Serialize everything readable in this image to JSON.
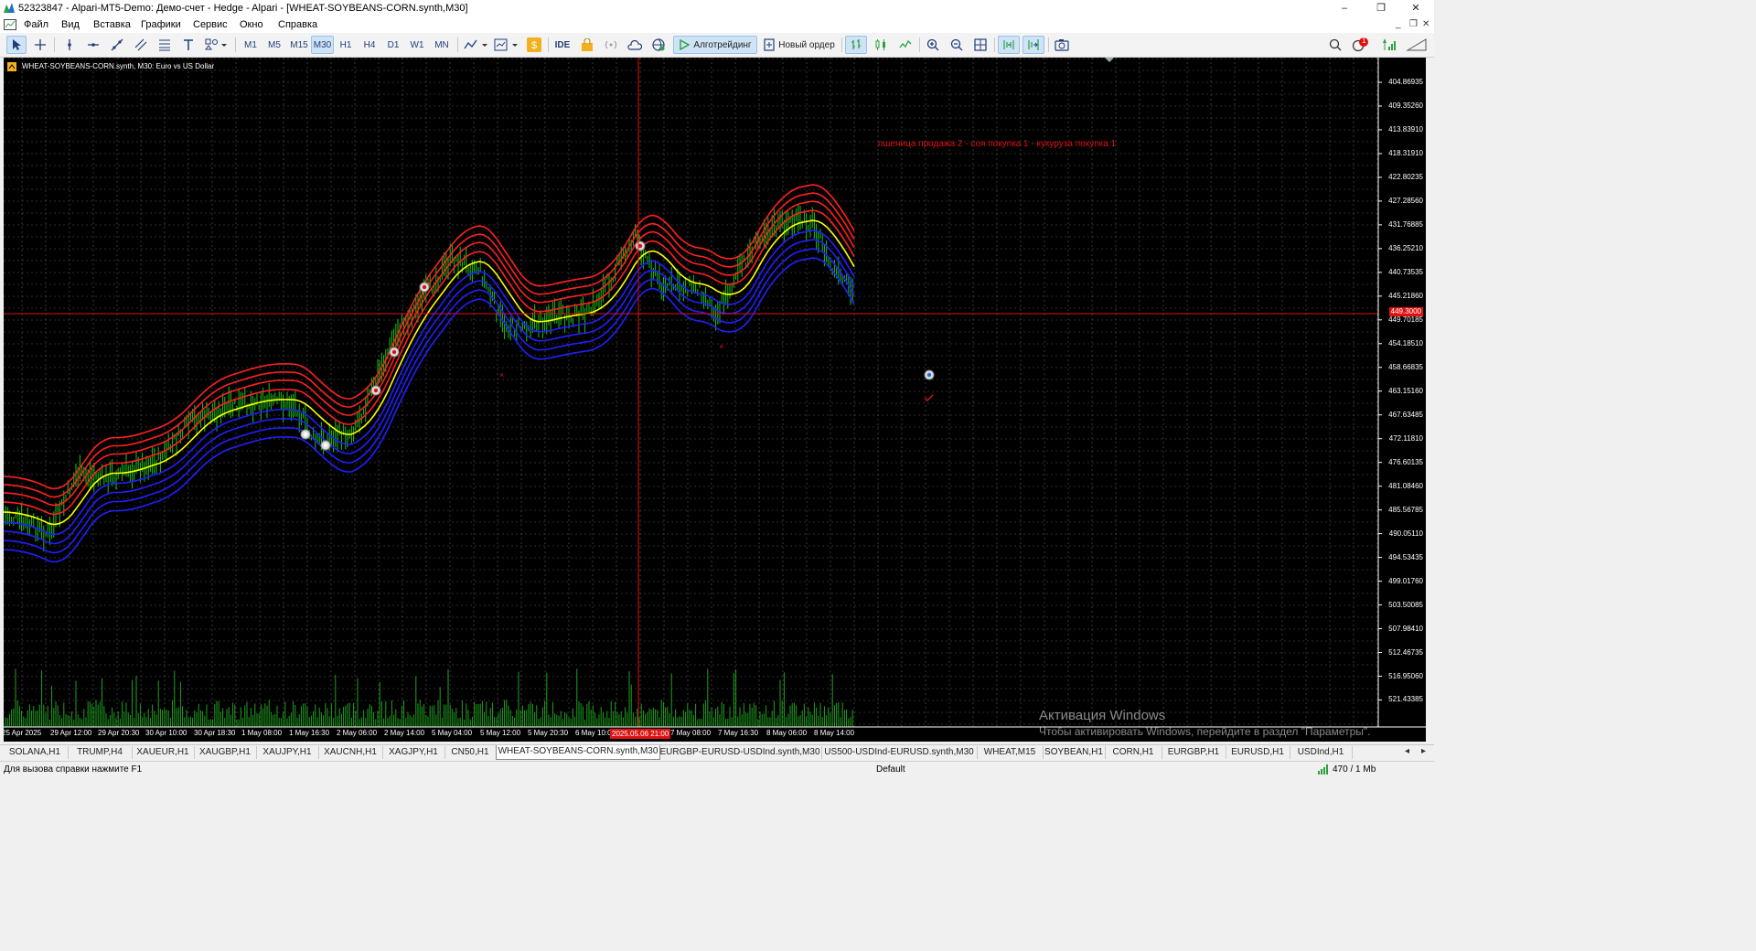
{
  "window": {
    "title": "52323847 - Alpari-MT5-Demo: Демо-счет - Hedge - Alpari - [WHEAT-SOYBEANS-CORN.synth,M30]",
    "minimize": "–",
    "restore": "❐",
    "close": "✕",
    "mdi_minimize": "_",
    "mdi_restore": "❐",
    "mdi_close": "✕"
  },
  "menu": [
    "Файл",
    "Вид",
    "Вставка",
    "Графики",
    "Сервис",
    "Окно",
    "Справка"
  ],
  "toolbar": {
    "timeframes": [
      "M1",
      "M5",
      "M15",
      "M30",
      "H1",
      "H4",
      "D1",
      "W1",
      "MN"
    ],
    "active_timeframe": "M30",
    "ide_label": "IDE",
    "algotrading_label": "Алготрейдинг",
    "new_order_label": "Новый ордер",
    "notification_count": "1"
  },
  "chart": {
    "symbol_label": "WHEAT-SOYBEANS-CORN.synth, M30:  Euro vs US Dollar",
    "annotation": "пшеница продажа 2 - соя покупка 1 - кукуруза покупка 1",
    "current_price": "449.3000",
    "crosshair_time": "2025.05.06 21:00",
    "colors": {
      "background": "#000000",
      "grid": "#5a5a5a",
      "bars": "#19c219",
      "volume": "#1fa01f",
      "band_upper": "#ff2020",
      "band_middle": "#ffff00",
      "band_lower": "#2020ff",
      "crosshair": "#e01010"
    },
    "price_axis": [
      "404.86935",
      "409.35260",
      "413.83910",
      "418.31910",
      "422.80235",
      "427.28560",
      "431.76885",
      "436.25210",
      "440.73535",
      "445.21860",
      "449.70185",
      "454.18510",
      "458.66835",
      "463.15160",
      "467.63485",
      "472.11810",
      "476.60135",
      "481.08460",
      "485.56785",
      "490.05110",
      "494.53435",
      "499.01760",
      "503.50085",
      "507.98410",
      "512.46735",
      "516.95060",
      "521.43385"
    ],
    "time_axis": [
      "25 Apr 2025",
      "29 Apr 12:00",
      "29 Apr 20:30",
      "30 Apr 10:00",
      "30 Apr 18:30",
      "1 May 08:00",
      "1 May 16:30",
      "2 May 06:00",
      "2 May 14:00",
      "5 May 04:00",
      "5 May 12:00",
      "5 May 20:30",
      "6 May 10:00",
      "7 May 08:00",
      "7 May 16:30",
      "8 May 06:00",
      "8 May 14:00"
    ]
  },
  "watermark": {
    "title": "Активация Windows",
    "text": "Чтобы активировать Windows, перейдите в раздел \"Параметры\"."
  },
  "tabs": [
    "SOLANA,H1",
    "TRUMP,H4",
    "XAUEUR,H1",
    "XAUGBP,H1",
    "XAUJPY,H1",
    "XAUCNH,H1",
    "XAGJPY,H1",
    "CN50,H1",
    "WHEAT-SOYBEANS-CORN.synth,M30",
    "EURGBP-EURUSD-USDInd.synth,M30",
    "US500-USDInd-EURUSD.synth,M30",
    "WHEAT,M15",
    "SOYBEAN,H1",
    "CORN,H1",
    "EURGBP,H1",
    "EURUSD,H1",
    "USDInd,H1"
  ],
  "active_tab": "WHEAT-SOYBEANS-CORN.synth,M30",
  "status": {
    "help": "Для вызова справки нажмите F1",
    "profile": "Default",
    "traffic": "470 / 1 Mb"
  }
}
